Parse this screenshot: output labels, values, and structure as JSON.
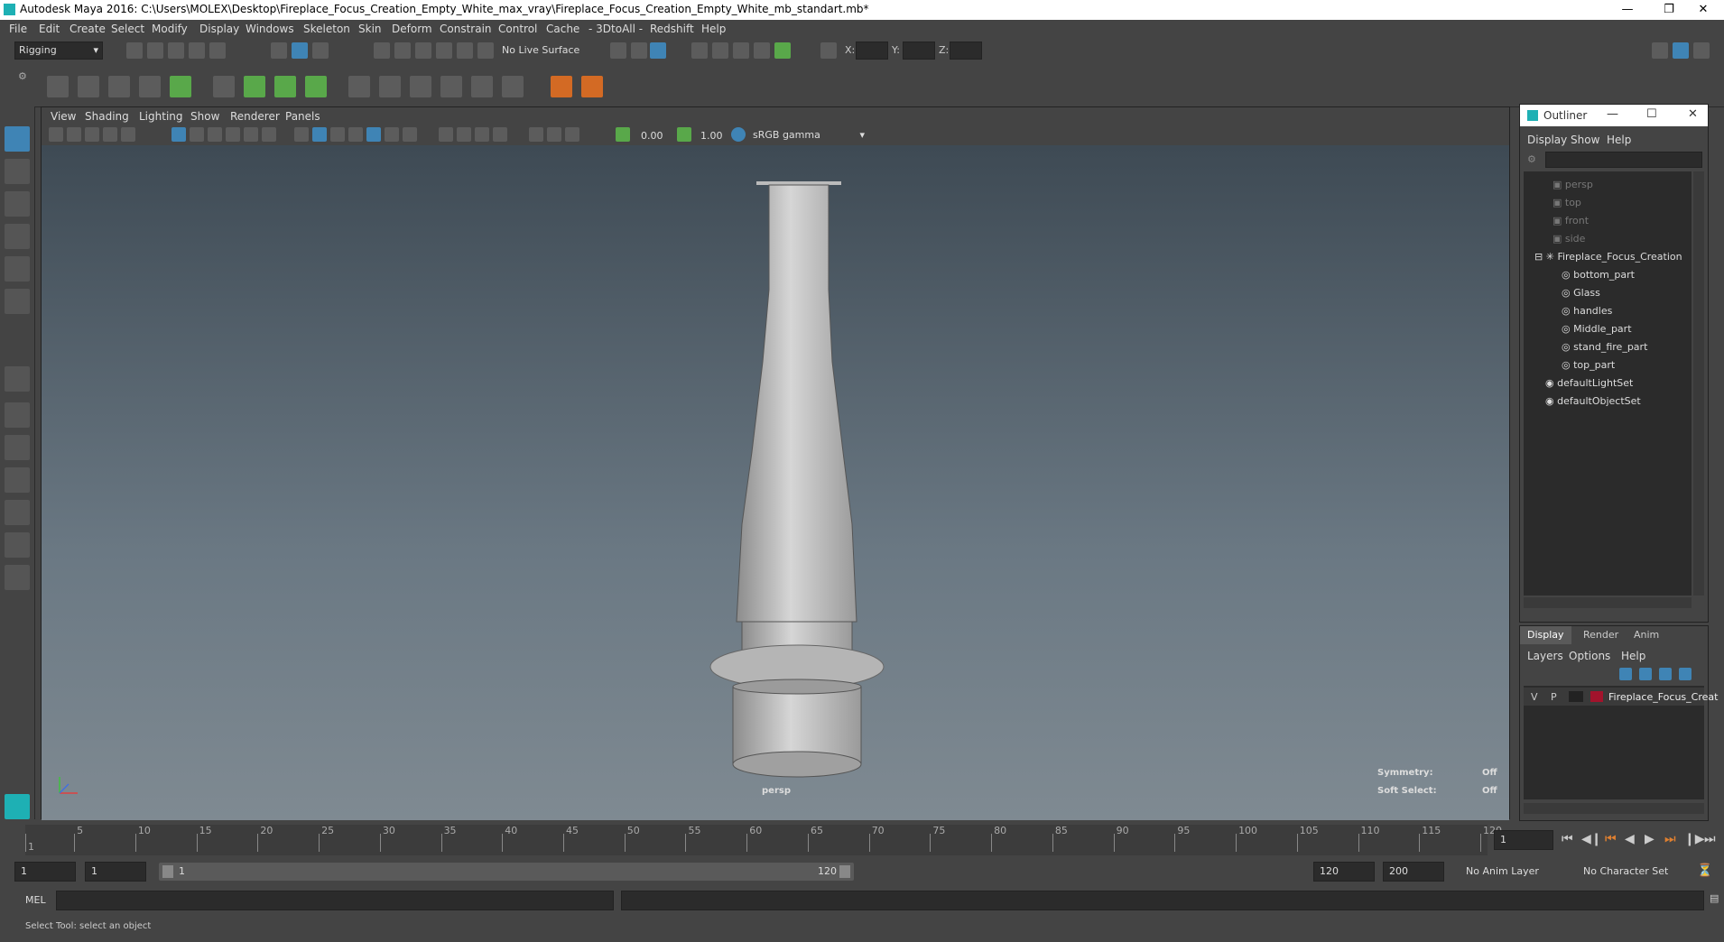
{
  "window": {
    "title": "Autodesk Maya 2016: C:\\Users\\MOLEX\\Desktop\\Fireplace_Focus_Creation_Empty_White_max_vray\\Fireplace_Focus_Creation_Empty_White_mb_standart.mb*"
  },
  "menubar": [
    "File",
    "Edit",
    "Create",
    "Select",
    "Modify",
    "Display",
    "Windows",
    "Skeleton",
    "Skin",
    "Deform",
    "Constrain",
    "Control",
    "Cache",
    "- 3DtoAll -",
    "Redshift",
    "Help"
  ],
  "status": {
    "mode": "Rigging",
    "live_surface": "No Live Surface",
    "x_label": "X:",
    "y_label": "Y:",
    "z_label": "Z:"
  },
  "viewport": {
    "menu": [
      "View",
      "Shading",
      "Lighting",
      "Show",
      "Renderer",
      "Panels"
    ],
    "exposure": "0.00",
    "gamma": "1.00",
    "color_space": "sRGB gamma",
    "camera": "persp",
    "symmetry_label": "Symmetry:",
    "symmetry_value": "Off",
    "soft_select_label": "Soft Select:",
    "soft_select_value": "Off"
  },
  "outliner": {
    "title": "Outliner",
    "menu": [
      "Display",
      "Show",
      "Help"
    ],
    "cameras": [
      "persp",
      "top",
      "front",
      "side"
    ],
    "group": "Fireplace_Focus_Creation",
    "children": [
      "bottom_part",
      "Glass",
      "handles",
      "Middle_part",
      "stand_fire_part",
      "top_part"
    ],
    "sets": [
      "defaultLightSet",
      "defaultObjectSet"
    ]
  },
  "layers": {
    "tabs": [
      "Display",
      "Render",
      "Anim"
    ],
    "menu": [
      "Layers",
      "Options",
      "Help"
    ],
    "v": "V",
    "p": "P",
    "layer_name": "Fireplace_Focus_Creat",
    "layer_color": "#a2132c"
  },
  "timeline": {
    "ticks": [
      "1",
      "5",
      "10",
      "15",
      "20",
      "25",
      "30",
      "35",
      "40",
      "45",
      "50",
      "55",
      "60",
      "65",
      "70",
      "75",
      "80",
      "85",
      "90",
      "95",
      "100",
      "105",
      "110",
      "115",
      "120"
    ],
    "current_frame": "1"
  },
  "range": {
    "start": "1",
    "start2": "1",
    "slider_start": "1",
    "slider_end": "120",
    "end": "120",
    "end2": "200",
    "anim_layer": "No Anim Layer",
    "char_set": "No Character Set"
  },
  "cmd": {
    "label": "MEL"
  },
  "help": {
    "text": "Select Tool: select an object"
  }
}
